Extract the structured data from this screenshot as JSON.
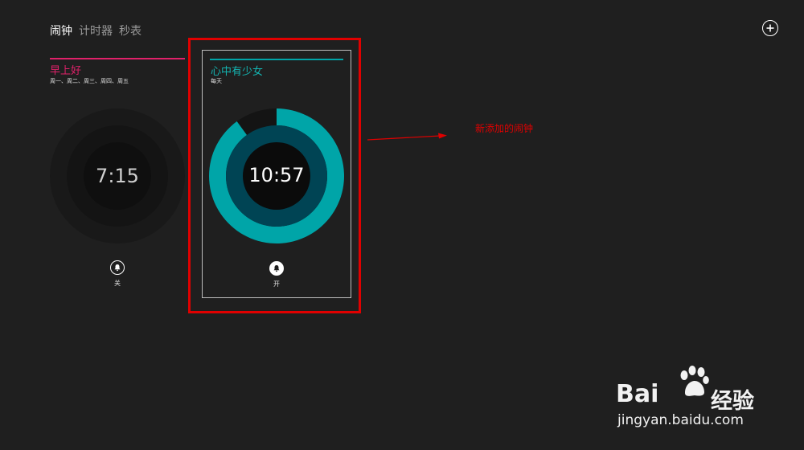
{
  "tabs": [
    {
      "label": "闹钟",
      "active": true
    },
    {
      "label": "计时器",
      "active": false
    },
    {
      "label": "秒表",
      "active": false
    }
  ],
  "add_button_icon": "plus-circle-icon",
  "alarms": [
    {
      "name": "早上好",
      "days": "周一、周二、周三、周四、周五",
      "time": "7:15",
      "state": "关",
      "accent": "#e0216a",
      "enabled": false
    },
    {
      "name": "心中有少女",
      "days": "每天",
      "time": "10:57",
      "state": "开",
      "accent": "#00a5a8",
      "enabled": true,
      "ring_fraction": 0.9
    }
  ],
  "annotation": {
    "text": "新添加的闹钟",
    "color": "#e00000"
  },
  "watermark": {
    "brand": "Bai",
    "brand_suffix": "经验",
    "url": "jingyan.baidu.com"
  }
}
